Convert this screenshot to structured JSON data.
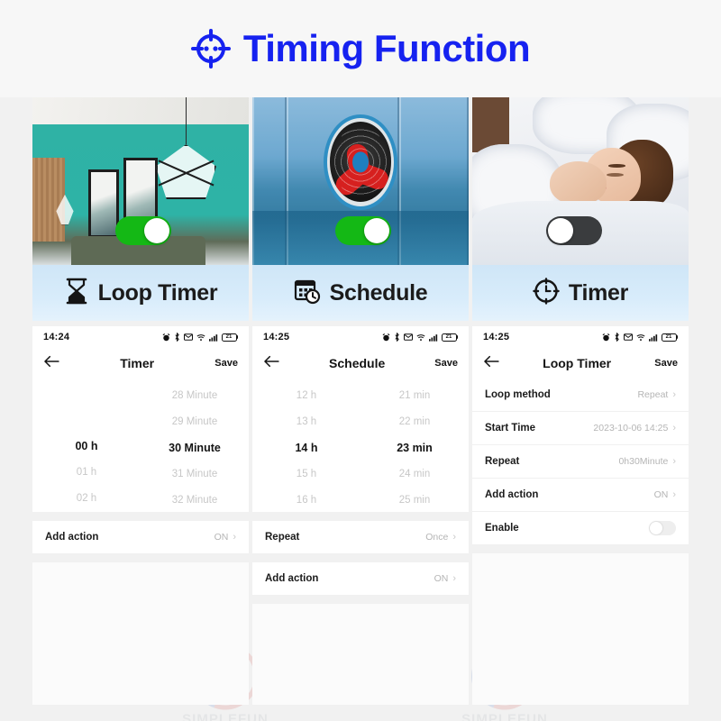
{
  "header": {
    "title": "Timing Function",
    "icon": "target-clock-icon",
    "accent_color": "#1622f0"
  },
  "watermark": {
    "text": "SIMPLEFUN"
  },
  "cards": [
    {
      "label": "Loop Timer",
      "icon": "hourglass-icon",
      "photo": "teal-living-room-photo",
      "toggle_state": "on"
    },
    {
      "label": "Schedule",
      "icon": "calendar-clock-icon",
      "photo": "exhaust-fan-photo",
      "toggle_state": "on"
    },
    {
      "label": "Timer",
      "icon": "clock-target-icon",
      "photo": "sleeping-woman-photo",
      "toggle_state": "off"
    }
  ],
  "phones": [
    {
      "status": {
        "time": "14:24",
        "battery": "21",
        "icons": [
          "alarm-icon",
          "bluetooth-icon",
          "mail-icon",
          "wifi-icon",
          "signal-icon",
          "battery-icon"
        ]
      },
      "nav": {
        "back": "←",
        "title": "Timer",
        "save": "Save"
      },
      "picker": {
        "columns": [
          {
            "name": "hours",
            "items": [
              "",
              "",
              "00 h",
              "01 h",
              "02 h"
            ],
            "selected_index": 2
          },
          {
            "name": "minutes",
            "items": [
              "28 Minute",
              "29 Minute",
              "30 Minute",
              "31 Minute",
              "32 Minute"
            ],
            "selected_index": 2
          }
        ]
      },
      "rows": [
        {
          "label": "Add action",
          "value": "ON",
          "chevron": "›"
        }
      ]
    },
    {
      "status": {
        "time": "14:25",
        "battery": "21",
        "icons": [
          "alarm-icon",
          "bluetooth-icon",
          "mail-icon",
          "wifi-icon",
          "signal-icon",
          "battery-icon"
        ]
      },
      "nav": {
        "back": "←",
        "title": "Schedule",
        "save": "Save"
      },
      "picker": {
        "columns": [
          {
            "name": "hours",
            "items": [
              "12 h",
              "13 h",
              "14 h",
              "15 h",
              "16 h"
            ],
            "selected_index": 2
          },
          {
            "name": "minutes",
            "items": [
              "21 min",
              "22 min",
              "23 min",
              "24 min",
              "25 min"
            ],
            "selected_index": 2
          }
        ]
      },
      "rows": [
        {
          "label": "Repeat",
          "value": "Once",
          "chevron": "›"
        },
        {
          "label": "Add action",
          "value": "ON",
          "chevron": "›"
        }
      ]
    },
    {
      "status": {
        "time": "14:25",
        "battery": "21",
        "icons": [
          "alarm-icon",
          "bluetooth-icon",
          "mail-icon",
          "wifi-icon",
          "signal-icon",
          "battery-icon"
        ]
      },
      "nav": {
        "back": "←",
        "title": "Loop Timer",
        "save": "Save"
      },
      "rows": [
        {
          "label": "Loop method",
          "value": "Repeat",
          "chevron": "›"
        },
        {
          "label": "Start Time",
          "value": "2023-10-06 14:25",
          "chevron": "›"
        },
        {
          "label": "Repeat",
          "value": "0h30Minute",
          "chevron": "›"
        },
        {
          "label": "Add action",
          "value": "ON",
          "chevron": "›"
        },
        {
          "label": "Enable",
          "value": "",
          "toggle_state": "off"
        }
      ]
    }
  ]
}
